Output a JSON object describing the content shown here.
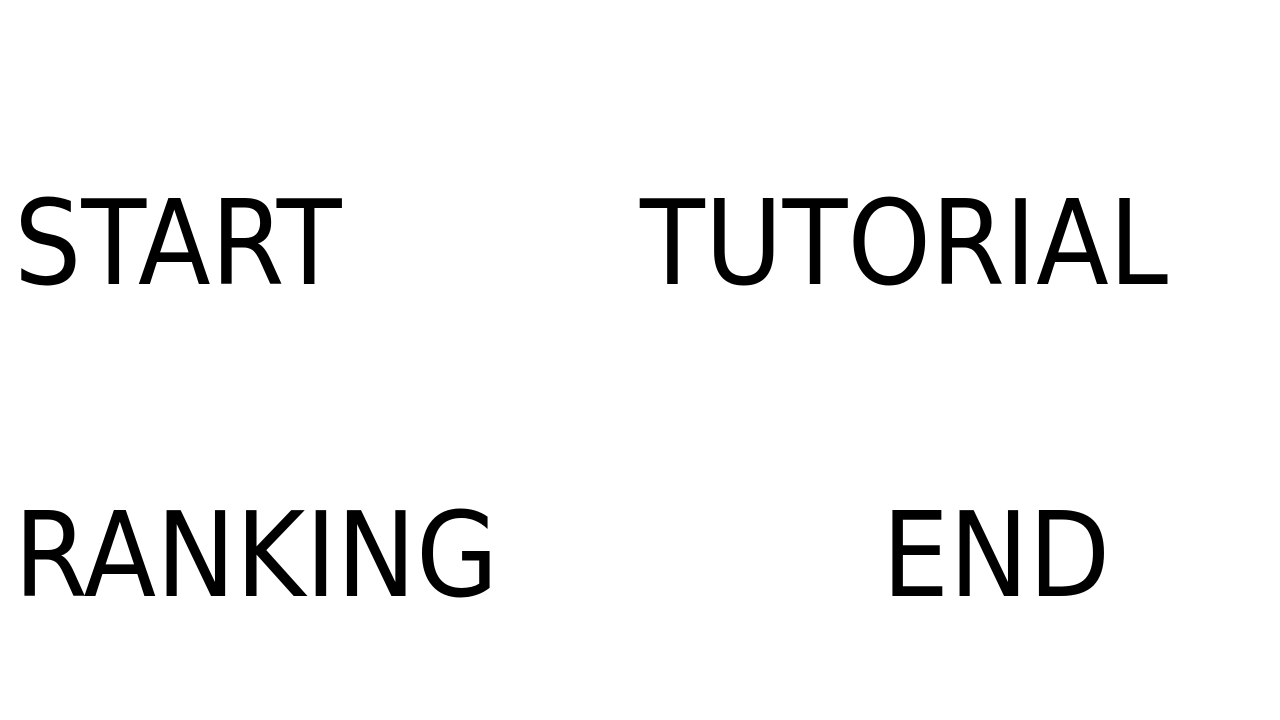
{
  "menu": {
    "start_label": "START",
    "tutorial_label": "TUTORIAL",
    "ranking_label": "RANKING",
    "end_label": "END"
  },
  "colors": {
    "background": "#ffffff",
    "text": "#000000"
  }
}
